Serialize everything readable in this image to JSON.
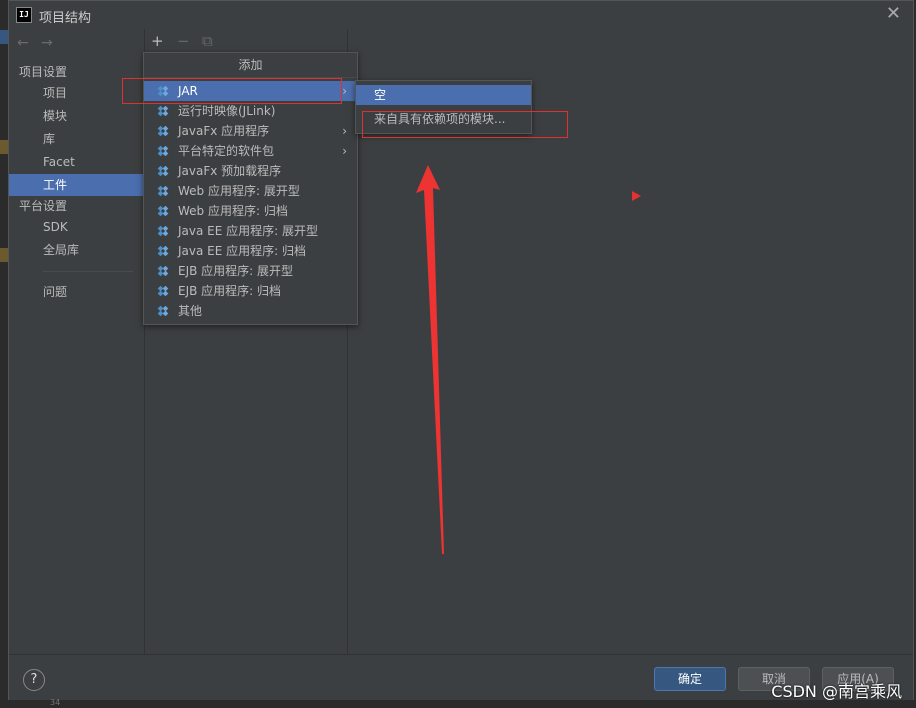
{
  "window": {
    "title": "项目结构",
    "app_icon_text": "IJ",
    "close_symbol": "✕"
  },
  "sidebar": {
    "back_symbol": "←",
    "forward_symbol": "→",
    "items": [
      {
        "label": "项目设置",
        "kind": "head"
      },
      {
        "label": "项目",
        "kind": "sub"
      },
      {
        "label": "模块",
        "kind": "sub"
      },
      {
        "label": "库",
        "kind": "sub"
      },
      {
        "label": "Facet",
        "kind": "sub"
      },
      {
        "label": "工件",
        "kind": "sub",
        "selected": true
      },
      {
        "label": "平台设置",
        "kind": "head"
      },
      {
        "label": "SDK",
        "kind": "sub"
      },
      {
        "label": "全局库",
        "kind": "sub"
      },
      {
        "label": "问题",
        "kind": "sub"
      }
    ]
  },
  "toolbar": {
    "add_symbol": "+",
    "remove_symbol": "−",
    "copy_symbol": "⧉"
  },
  "add_menu": {
    "header": "添加",
    "items": [
      {
        "label": "JAR",
        "has_submenu": true,
        "highlighted": true
      },
      {
        "label": "运行时映像(JLink)"
      },
      {
        "label": "JavaFx 应用程序",
        "has_submenu": true
      },
      {
        "label": "平台特定的软件包",
        "has_submenu": true
      },
      {
        "label": "JavaFx 预加载程序"
      },
      {
        "label": "Web 应用程序: 展开型"
      },
      {
        "label": "Web 应用程序: 归档"
      },
      {
        "label": "Java EE 应用程序: 展开型"
      },
      {
        "label": "Java EE 应用程序: 归档"
      },
      {
        "label": "EJB 应用程序: 展开型"
      },
      {
        "label": "EJB 应用程序: 归档"
      },
      {
        "label": "其他"
      }
    ],
    "submenu_arrow": "›"
  },
  "jar_submenu": {
    "items": [
      {
        "label": "空",
        "highlighted": true
      },
      {
        "label": "来自具有依赖项的模块..."
      }
    ]
  },
  "footer": {
    "help_symbol": "?",
    "ok_label": "确定",
    "cancel_label": "取消",
    "apply_label": "应用(A)"
  },
  "watermark": "CSDN @南宫乘风",
  "bottom_fragment": "34",
  "colors": {
    "background": "#3c3f41",
    "selection": "#4b6eaf",
    "annotation_red": "#e03030",
    "primary_button": "#365880"
  }
}
